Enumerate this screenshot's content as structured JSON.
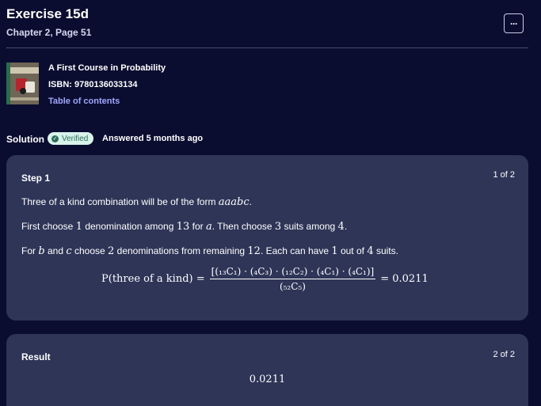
{
  "header": {
    "title": "Exercise 15d",
    "subtitle": "Chapter 2, Page 51",
    "more_label": "···"
  },
  "book": {
    "title": "A First Course in Probability",
    "isbn": "ISBN: 9780136033134",
    "toc_link": "Table of contents"
  },
  "solution": {
    "label": "Solution",
    "badge": "Verified",
    "badge_icon": "check-circle-icon",
    "answered": "Answered 5 months ago"
  },
  "step": {
    "heading": "Step 1",
    "counter": "1 of 2",
    "line1": {
      "text": "Three of a kind combination will be of the form ",
      "math": "aaabc",
      "end": "."
    },
    "line2": {
      "t1": "First choose ",
      "m1": "1",
      "t2": " denomination among ",
      "m2": "13",
      "t3": " for ",
      "m3": "a",
      "t4": ". Then choose ",
      "m4": "3",
      "t5": " suits among ",
      "m5": "4",
      "t6": "."
    },
    "line3": {
      "t1": "For ",
      "m1": "b",
      "t2": " and ",
      "m2": "c",
      "t3": " choose ",
      "m3": "2",
      "t4": " denominations from remaining ",
      "m4": "12",
      "t5": ". Each can have ",
      "m5": "1",
      "t6": " out of ",
      "m6": "4",
      "t7": " suits."
    },
    "formula": {
      "lhs": "P(three of a kind) =",
      "numerator": "[(₁₃C₁) · (₄C₃) · (₁₂C₂) · (₄C₁) · (₄C₁)]",
      "denominator": "(₅₂C₅)",
      "rhs": "= 0.0211"
    }
  },
  "result": {
    "heading": "Result",
    "counter": "2 of 2",
    "value": "0.0211"
  },
  "colors": {
    "background": "#0b0d30",
    "card": "#2e3557",
    "link": "#9fa7ff",
    "badge_bg": "#d8f4ea",
    "badge_fg": "#2e6e5a"
  }
}
